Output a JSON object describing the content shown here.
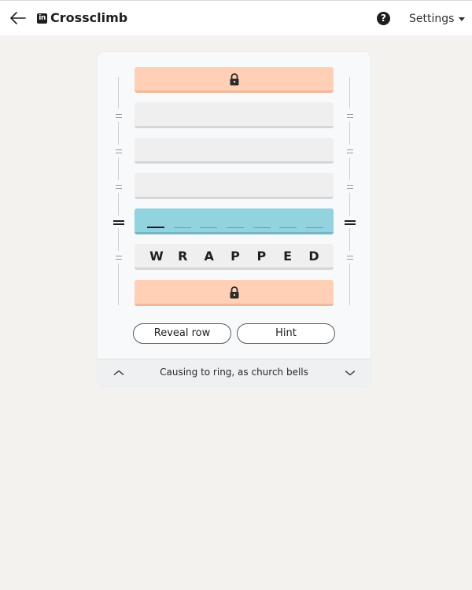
{
  "header": {
    "logo_text": "in",
    "title": "Crossclimb",
    "help_icon": "?",
    "settings_label": "Settings"
  },
  "rows": [
    {
      "state": "locked",
      "icon": "lock-icon"
    },
    {
      "state": "empty"
    },
    {
      "state": "empty"
    },
    {
      "state": "empty"
    },
    {
      "state": "active",
      "slots": 7
    },
    {
      "state": "filled",
      "letters": [
        "W",
        "R",
        "A",
        "P",
        "P",
        "E",
        "D"
      ]
    },
    {
      "state": "locked",
      "icon": "lock-icon"
    }
  ],
  "actions": {
    "reveal_label": "Reveal row",
    "hint_label": "Hint"
  },
  "clue": {
    "text": "Causing to ring, as church bells"
  },
  "colors": {
    "locked_row": "#ffd0b5",
    "active_row": "#93d2df",
    "empty_row": "#efefef",
    "page_background": "#f3f2ef"
  }
}
